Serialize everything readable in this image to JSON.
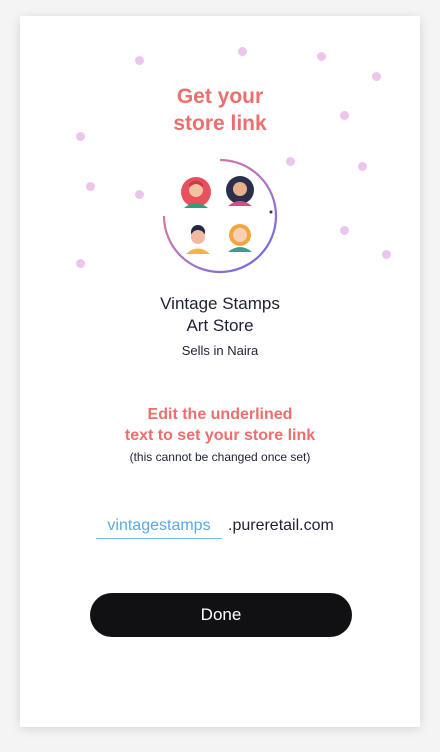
{
  "header": {
    "title_line1": "Get your",
    "title_line2": "store link"
  },
  "store": {
    "name_line1": "Vintage Stamps",
    "name_line2": "Art Store",
    "currency_text": "Sells in Naira"
  },
  "instructions": {
    "line1": "Edit the underlined",
    "line2": "text to set your store link",
    "note": "(this cannot be changed once set)"
  },
  "store_link": {
    "slug_value": "vintagestamps",
    "domain": ".pureretail.com"
  },
  "actions": {
    "done_label": "Done"
  },
  "colors": {
    "accent": "#ee6e6e",
    "link": "#5aa9e6",
    "button": "#111114",
    "decor_dot": "#ecc4ec"
  },
  "icons": [
    "team-avatars-icon"
  ]
}
